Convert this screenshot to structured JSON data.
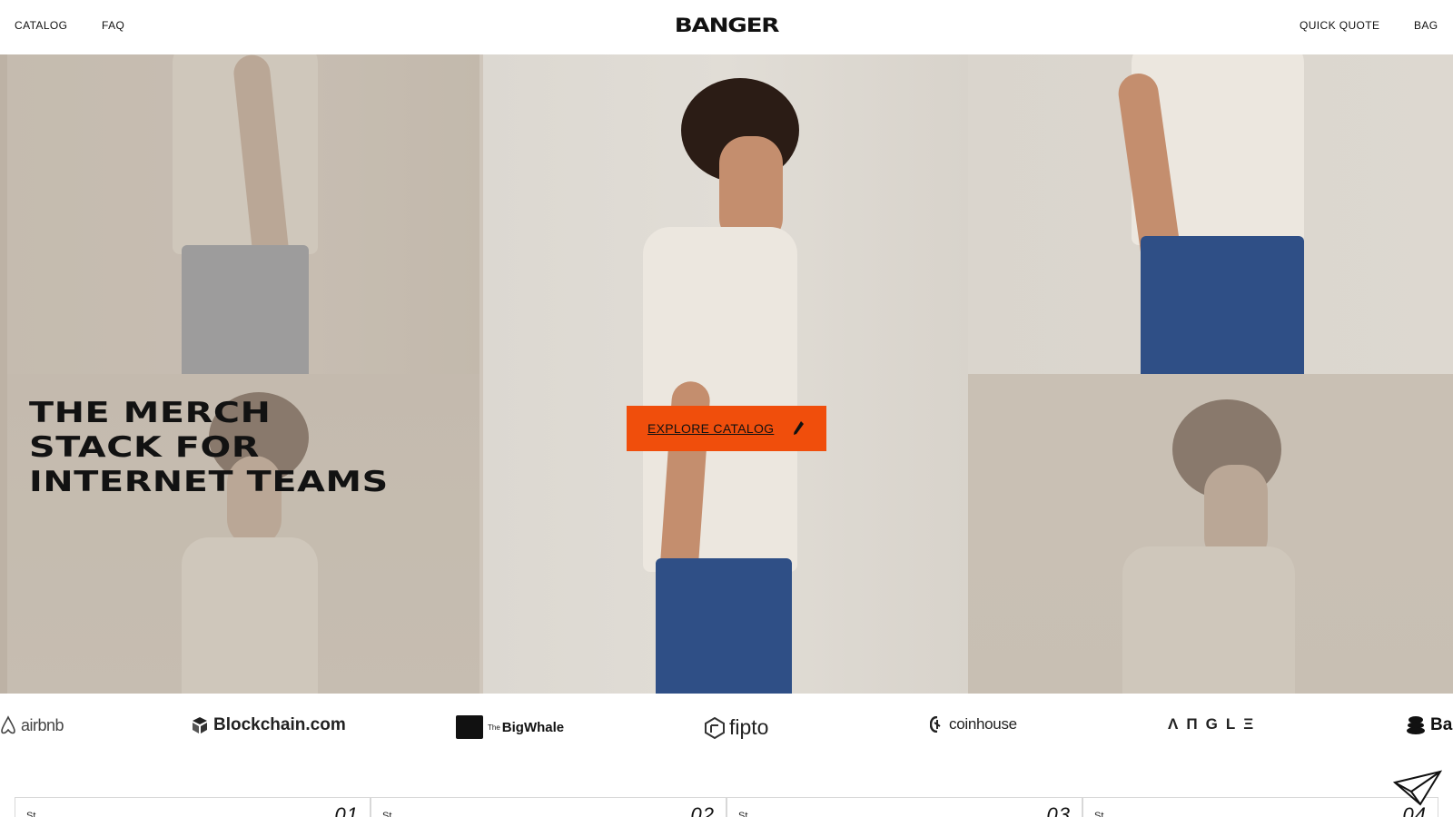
{
  "header": {
    "nav_left": [
      "CATALOG",
      "FAQ"
    ],
    "logo": "BANGER",
    "nav_right": [
      "QUICK QUOTE",
      "BAG"
    ]
  },
  "hero": {
    "headline": [
      "THE MERCH",
      "STACK FOR",
      "INTERNET TEAMS"
    ],
    "cta_label": "EXPLORE CATALOG",
    "cta_icon": "pencil-icon",
    "cta_color": "#f04e0c"
  },
  "brands": [
    {
      "name": "airbnb",
      "icon": "airbnb-icon"
    },
    {
      "name": "Blockchain.com",
      "icon": "blockchain-icon"
    },
    {
      "name": "BigWhale",
      "prefix": "The",
      "icon": "bigwhale-icon"
    },
    {
      "name": "fipto",
      "icon": "fipto-icon"
    },
    {
      "name": "coinhouse",
      "icon": "coinhouse-icon"
    },
    {
      "name": "ΛΠGLΞ",
      "icon": ""
    },
    {
      "name": "Ba",
      "icon": "stack-icon"
    }
  ],
  "cards": [
    {
      "label": "St",
      "number": "01"
    },
    {
      "label": "St",
      "number": "02"
    },
    {
      "label": "St",
      "number": "03"
    },
    {
      "label": "St",
      "number": "04"
    }
  ],
  "floating_icon": "paper-plane-icon"
}
